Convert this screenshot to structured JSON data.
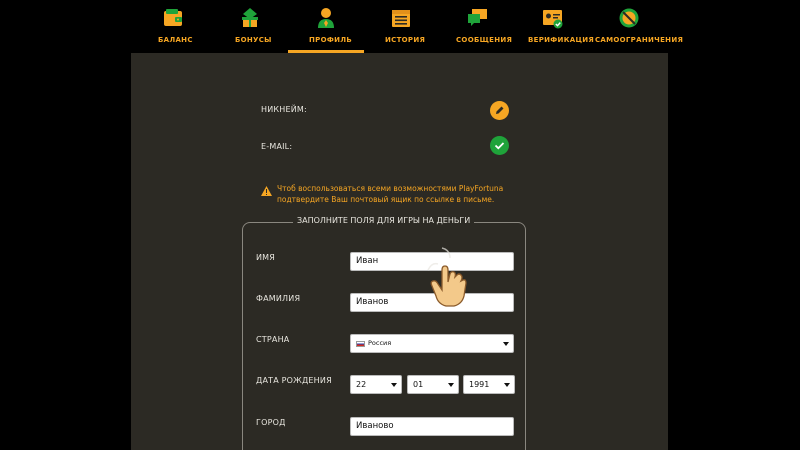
{
  "nav": {
    "items": [
      {
        "label": "БАЛАНС",
        "icon": "wallet-icon"
      },
      {
        "label": "БОНУСЫ",
        "icon": "gift-icon"
      },
      {
        "label": "ПРОФИЛЬ",
        "icon": "profile-icon"
      },
      {
        "label": "ИСТОРИЯ",
        "icon": "history-icon"
      },
      {
        "label": "СООБЩЕНИЯ",
        "icon": "messages-icon"
      },
      {
        "label": "ВЕРИФИКАЦИЯ",
        "icon": "verification-icon"
      },
      {
        "label": "САМООГРАНИЧЕНИЯ",
        "icon": "self-exclusion-icon"
      }
    ],
    "active": "ПРОФИЛЬ"
  },
  "profile": {
    "nickname_label": "НИКНЕЙМ:",
    "email_label": "E-MAIL:"
  },
  "warning": {
    "line1": "Чтоб воспользоваться всеми возможностями PlayFortuna",
    "line2": "подтвердите Ваш почтовый ящик по ссылке в письме."
  },
  "form": {
    "legend": "ЗАПОЛНИТЕ ПОЛЯ ДЛЯ ИГРЫ НА ДЕНЬГИ",
    "first_name_label": "ИМЯ",
    "first_name_value": "Иван",
    "last_name_label": "ФАМИЛИЯ",
    "last_name_value": "Иванов",
    "country_label": "СТРАНА",
    "country_value": "Россия",
    "birth_label": "ДАТА РОЖДЕНИЯ",
    "birth_day": "22",
    "birth_month": "01",
    "birth_year": "1991",
    "city_label": "ГОРОД",
    "city_value": "Иваново"
  },
  "colors": {
    "accent": "#f6a623",
    "icon_green": "#1fa33a",
    "panel": "#2c2a24",
    "verified": "#1fa33a"
  }
}
